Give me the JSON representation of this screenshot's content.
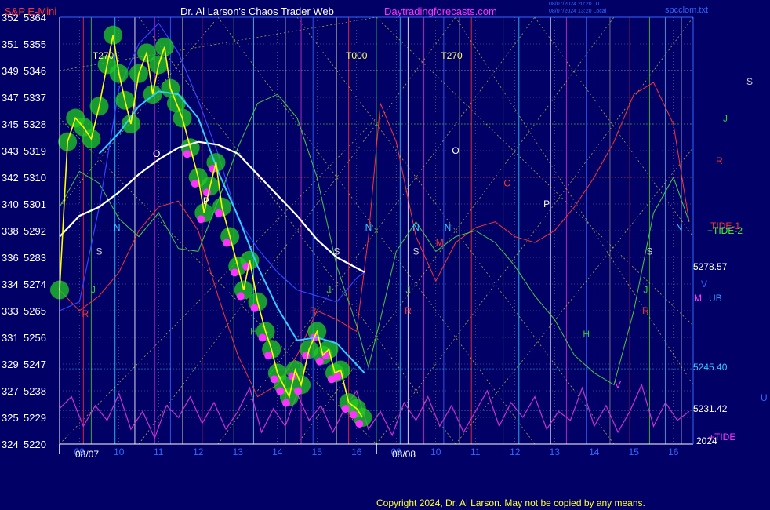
{
  "header": {
    "instrument": "S&P E-Mini",
    "title": "Dr. Al Larson's Chaos Trader Web",
    "site": "Daytradingforecasts.com",
    "stamp1": "08/07/2024 20:20 UT",
    "stamp2": "08/07/2024 13:20 Local",
    "file": "spcclom.txt"
  },
  "colors": {
    "background": "#000066",
    "axis": "#ffffff",
    "price": "#ffff00",
    "halo": "#22cc22",
    "dots": "#ff33ff",
    "ma_fast": "#33ccff",
    "ma_slow": "#ffffff",
    "tide": "#cc33cc",
    "red_line": "#ff3333",
    "green_line": "#44cc44",
    "blue_line": "#3344ff"
  },
  "chart_data": {
    "type": "line",
    "y_left_ticks": [
      {
        "num": "352",
        "price": "5364"
      },
      {
        "num": "351",
        "price": "5355"
      },
      {
        "num": "349",
        "price": "5346"
      },
      {
        "num": "347",
        "price": "5337"
      },
      {
        "num": "345",
        "price": "5328"
      },
      {
        "num": "343",
        "price": "5319"
      },
      {
        "num": "342",
        "price": "5310"
      },
      {
        "num": "340",
        "price": "5301"
      },
      {
        "num": "338",
        "price": "5292"
      },
      {
        "num": "336",
        "price": "5283"
      },
      {
        "num": "334",
        "price": "5274"
      },
      {
        "num": "333",
        "price": "5265"
      },
      {
        "num": "331",
        "price": "5256"
      },
      {
        "num": "329",
        "price": "5247"
      },
      {
        "num": "327",
        "price": "5238"
      },
      {
        "num": "325",
        "price": "5229"
      },
      {
        "num": "324",
        "price": "5220"
      }
    ],
    "ylim": [
      5220,
      5364
    ],
    "x_hour_labels": [
      "09",
      "10",
      "11",
      "12",
      "13",
      "14",
      "15",
      "16",
      "09",
      "10",
      "11",
      "12",
      "13",
      "14",
      "15",
      "16"
    ],
    "x_date_labels": [
      "08/07",
      "08/08"
    ],
    "x_dates": [
      {
        "label": "08/07",
        "hour": 8.5
      },
      {
        "label": "08/08",
        "hour": 16.5
      }
    ],
    "xlim_hours": [
      8.5,
      24.5
    ],
    "right_labels": [
      {
        "text": "S",
        "color": "#cccccc"
      },
      {
        "text": "J",
        "color": "#33cc33"
      },
      {
        "text": "R",
        "color": "#ff3333"
      },
      {
        "text": "TIDE-1",
        "color": "#ff3333"
      },
      {
        "text": "+TIDE-2",
        "color": "#33ff33"
      },
      {
        "text": "5278.57",
        "color": "#ffffff"
      },
      {
        "text": "M",
        "color": "#ff33ff"
      },
      {
        "text": "UB",
        "color": "#3399ff"
      },
      {
        "text": "V",
        "color": "#3366ff"
      },
      {
        "text": "5245.40",
        "color": "#33ccff"
      },
      {
        "text": "U",
        "color": "#3366ff"
      },
      {
        "text": "5231.42",
        "color": "#ffffff"
      },
      {
        "text": "2024",
        "color": "#ffffff"
      },
      {
        "text": "+TIDE",
        "color": "#ff33ff"
      }
    ],
    "top_markers": [
      "T270",
      "T000",
      "T270"
    ],
    "chart_letters": [
      {
        "text": "O",
        "color": "#ffffff"
      },
      {
        "text": "N",
        "color": "#33ccff"
      },
      {
        "text": "S",
        "color": "#cccccc"
      },
      {
        "text": "J",
        "color": "#33cc33"
      },
      {
        "text": "R",
        "color": "#ff3333"
      },
      {
        "text": "P",
        "color": "#ffffff"
      },
      {
        "text": "H",
        "color": "#33cc33"
      },
      {
        "text": "N",
        "color": "#33ccff"
      },
      {
        "text": "S",
        "color": "#cccccc"
      },
      {
        "text": "J",
        "color": "#33cc33"
      },
      {
        "text": "R",
        "color": "#ff3333"
      },
      {
        "text": "N",
        "color": "#33ccff"
      },
      {
        "text": "S",
        "color": "#cccccc"
      },
      {
        "text": "J",
        "color": "#33cc33"
      },
      {
        "text": "R",
        "color": "#ff3333"
      },
      {
        "text": "O",
        "color": "#ffffff"
      },
      {
        "text": "N",
        "color": "#33ccff"
      },
      {
        "text": "M",
        "color": "#ff3333"
      },
      {
        "text": "C",
        "color": "#ff3333"
      },
      {
        "text": "P",
        "color": "#ffffff"
      },
      {
        "text": "H",
        "color": "#33cc33"
      },
      {
        "text": "V",
        "color": "#ff33ff"
      },
      {
        "text": "S",
        "color": "#cccccc"
      },
      {
        "text": "J",
        "color": "#33cc33"
      },
      {
        "text": "R",
        "color": "#ff3333"
      },
      {
        "text": "N",
        "color": "#33ccff"
      }
    ],
    "series": [
      {
        "name": "price",
        "x": [
          8.5,
          8.7,
          8.9,
          9.1,
          9.3,
          9.5,
          9.7,
          9.85,
          10.0,
          10.15,
          10.3,
          10.5,
          10.7,
          10.85,
          11.0,
          11.15,
          11.3,
          11.45,
          11.6,
          11.8,
          12.0,
          12.15,
          12.3,
          12.45,
          12.6,
          12.8,
          13.0,
          13.15,
          13.3,
          13.5,
          13.7,
          13.85,
          14.0,
          14.15,
          14.3,
          14.45,
          14.6,
          14.8,
          15.0,
          15.15,
          15.3,
          15.45,
          15.6,
          15.8,
          16.0,
          16.15
        ],
        "y": [
          5272,
          5322,
          5330,
          5327,
          5323,
          5334,
          5348,
          5358,
          5345,
          5336,
          5328,
          5345,
          5352,
          5338,
          5348,
          5354,
          5340,
          5335,
          5330,
          5320,
          5310,
          5298,
          5307,
          5315,
          5300,
          5290,
          5280,
          5272,
          5282,
          5268,
          5258,
          5252,
          5244,
          5240,
          5236,
          5245,
          5240,
          5252,
          5258,
          5250,
          5252,
          5244,
          5245,
          5234,
          5232,
          5229
        ]
      },
      {
        "name": "ma_fast",
        "x": [
          9.5,
          10.0,
          10.5,
          11.0,
          11.5,
          12.0,
          12.5,
          13.0,
          13.5,
          14.0,
          14.5,
          15.0,
          15.5,
          16.2
        ],
        "y": [
          5318,
          5325,
          5334,
          5339,
          5338,
          5330,
          5312,
          5297,
          5280,
          5266,
          5255,
          5256,
          5254,
          5244
        ]
      },
      {
        "name": "ma_slow",
        "x": [
          8.5,
          9.0,
          9.5,
          10.0,
          10.5,
          11.0,
          11.5,
          12.0,
          12.5,
          13.0,
          13.5,
          14.0,
          14.5,
          15.0,
          15.5,
          16.2
        ],
        "y": [
          5290,
          5297,
          5300,
          5305,
          5311,
          5316,
          5320,
          5322,
          5321,
          5318,
          5311,
          5304,
          5297,
          5289,
          5283,
          5278
        ]
      },
      {
        "name": "tide",
        "x": [
          8.5,
          8.8,
          9.1,
          9.4,
          9.7,
          10.0,
          10.3,
          10.6,
          10.9,
          11.2,
          11.5,
          11.8,
          12.1,
          12.4,
          12.7,
          13.0,
          13.3,
          13.6,
          13.9,
          14.2,
          14.5,
          14.8,
          15.1,
          15.4,
          15.7,
          16.0,
          16.3,
          16.6,
          16.9,
          17.2,
          17.5,
          17.8,
          18.1,
          18.4,
          18.7,
          19.0,
          19.3,
          19.6,
          19.9,
          20.2,
          20.5,
          20.8,
          21.1,
          21.4,
          21.7,
          22.0,
          22.3,
          22.6,
          22.9,
          23.2,
          23.5,
          23.8,
          24.1,
          24.4
        ],
        "y": [
          5232,
          5236,
          5226,
          5233,
          5228,
          5237,
          5225,
          5231,
          5222,
          5233,
          5229,
          5236,
          5227,
          5234,
          5225,
          5231,
          5239,
          5224,
          5232,
          5226,
          5237,
          5228,
          5233,
          5224,
          5232,
          5238,
          5225,
          5231,
          5223,
          5234,
          5228,
          5236,
          5226,
          5233,
          5224,
          5231,
          5238,
          5226,
          5234,
          5229,
          5236,
          5225,
          5231,
          5228,
          5239,
          5226,
          5233,
          5224,
          5231,
          5240,
          5226,
          5234,
          5228,
          5231
        ]
      },
      {
        "name": "red",
        "x": [
          8.5,
          9.0,
          9.5,
          10.0,
          10.5,
          11.0,
          11.5,
          12.0,
          12.5,
          13.0,
          13.5,
          14.0,
          14.5,
          15.0,
          15.5,
          16.0,
          16.3,
          16.6,
          17.0,
          17.5,
          18.0,
          18.5,
          19.0,
          19.5,
          20.0,
          20.5,
          21.0,
          21.5,
          22.0,
          22.5,
          23.0,
          23.5,
          24.0,
          24.4
        ],
        "y": [
          5272,
          5265,
          5270,
          5278,
          5292,
          5300,
          5302,
          5292,
          5270,
          5250,
          5236,
          5240,
          5250,
          5265,
          5262,
          5258,
          5290,
          5335,
          5322,
          5290,
          5275,
          5288,
          5293,
          5295,
          5290,
          5288,
          5292,
          5300,
          5310,
          5322,
          5338,
          5342,
          5328,
          5295
        ]
      },
      {
        "name": "green",
        "x": [
          8.5,
          9.0,
          9.5,
          10.0,
          10.5,
          11.0,
          11.5,
          12.0,
          12.5,
          13.0,
          13.5,
          14.0,
          14.5,
          15.0,
          15.5,
          16.0,
          16.3,
          16.6,
          17.0,
          17.5,
          18.0,
          18.5,
          19.0,
          19.5,
          20.0,
          20.5,
          21.0,
          21.5,
          22.0,
          22.5,
          23.0,
          23.5,
          24.0,
          24.4
        ],
        "y": [
          5300,
          5312,
          5308,
          5296,
          5290,
          5298,
          5286,
          5285,
          5302,
          5320,
          5335,
          5338,
          5330,
          5310,
          5280,
          5260,
          5246,
          5262,
          5285,
          5295,
          5285,
          5290,
          5292,
          5288,
          5280,
          5270,
          5262,
          5250,
          5244,
          5240,
          5265,
          5298,
          5310,
          5295
        ]
      },
      {
        "name": "blue",
        "x": [
          8.5,
          9.0,
          9.5,
          10.0,
          10.5,
          11.0,
          11.5,
          12.0,
          12.5,
          13.0,
          13.5,
          14.0,
          14.5,
          15.0,
          15.5,
          16.0,
          16.2
        ],
        "y": [
          5265,
          5268,
          5300,
          5340,
          5355,
          5362,
          5352,
          5336,
          5318,
          5296,
          5286,
          5278,
          5272,
          5270,
          5268,
          5276,
          5278
        ]
      }
    ]
  },
  "footer": {
    "copyright": "Copyright 2024, Dr. Al Larson. May not be copied by any means."
  }
}
